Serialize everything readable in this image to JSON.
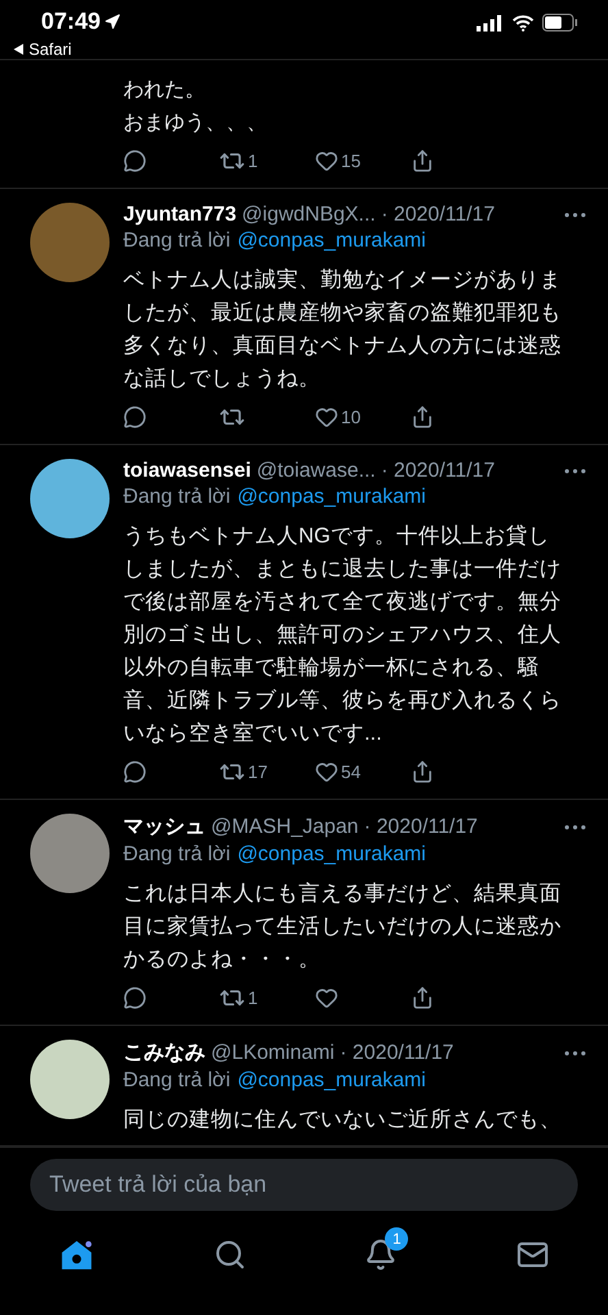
{
  "status_bar": {
    "time": "07:49",
    "back_label": "Safari"
  },
  "previous_tweet": {
    "lines": [
      "われた。",
      "おまゆう、、、"
    ],
    "actions": {
      "retweets": "1",
      "likes": "15"
    }
  },
  "tweets": [
    {
      "name": "Jyuntan773",
      "handle": "@igwdNBgX...",
      "date": "· 2020/11/17",
      "reply_prefix": "Đang trả lời",
      "reply_to": "@conpas_murakami",
      "text": "ベトナム人は誠実、勤勉なイメージがありましたが、最近は農産物や家畜の盗難犯罪犯も多くなり、真面目なベトナム人の方には迷惑な話しでしょうね。",
      "actions": {
        "likes": "10"
      }
    },
    {
      "name": "toiawasensei",
      "handle": "@toiawase...",
      "date": "· 2020/11/17",
      "reply_prefix": "Đang trả lời",
      "reply_to": "@conpas_murakami",
      "text": "うちもベトナム人NGです。十件以上お貸ししましたが、まともに退去した事は一件だけで後は部屋を汚されて全て夜逃げです。無分別のゴミ出し、無許可のシェアハウス、住人以外の自転車で駐輪場が一杯にされる、騒音、近隣トラブル等、彼らを再び入れるくらいなら空き室でいいです...",
      "actions": {
        "retweets": "17",
        "likes": "54"
      }
    },
    {
      "name": "マッシュ",
      "handle": "@MASH_Japan",
      "date": "· 2020/11/17",
      "reply_prefix": "Đang trả lời",
      "reply_to": "@conpas_murakami",
      "text": "これは日本人にも言える事だけど、結果真面目に家賃払って生活したいだけの人に迷惑かかるのよね・・・。",
      "actions": {
        "retweets": "1"
      }
    },
    {
      "name": "こみなみ",
      "handle": "@LKominami",
      "date": "· 2020/11/17",
      "reply_prefix": "Đang trả lời",
      "reply_to": "@conpas_murakami",
      "text": "同じの建物に住んでいないご近所さんでも、"
    }
  ],
  "reply_field": {
    "placeholder": "Tweet trả lời của bạn"
  },
  "tab_bar": [
    {
      "kind": "home",
      "selected": true
    },
    {
      "kind": "search",
      "selected": false
    },
    {
      "kind": "notifications",
      "selected": false,
      "badge": "1"
    },
    {
      "kind": "messages",
      "selected": false
    }
  ]
}
